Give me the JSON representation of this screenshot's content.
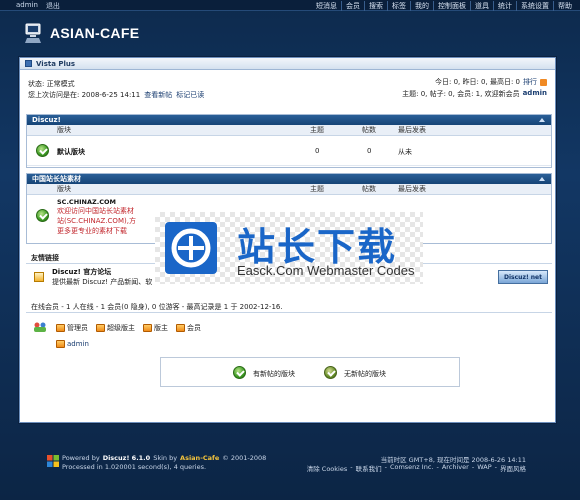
{
  "topbar": {
    "username": "admin",
    "logout": "退出",
    "nav": [
      "短消息",
      "会员",
      "搜索",
      "标签",
      "我的",
      "控制面板",
      "道具",
      "统计",
      "系统设置",
      "帮助"
    ]
  },
  "logo": {
    "text": "ASIAN-CAFE"
  },
  "window": {
    "title": "Vista Plus"
  },
  "status": {
    "mode": "状态: 正常模式",
    "last_visit": "您上次访问是在: 2008-6-25 14:11",
    "view_new": "查看新帖",
    "mark_read": "标记已读",
    "stats_today": "今日: 0, 昨日: 0, 最高日: 0",
    "ranking": "排行",
    "stats_totals": "主题: 0, 帖子: 0, 会员: 1, 欢迎新会员",
    "newest_member": "admin"
  },
  "discuz_section": {
    "title": "Discuz!",
    "columns": [
      "版块",
      "主题",
      "帖数",
      "最后发表"
    ],
    "rows": [
      {
        "name": "默认版块",
        "topics": "0",
        "posts": "0",
        "last": "从未"
      }
    ]
  },
  "chinaz_section": {
    "title": "中国站长站素材",
    "columns": [
      "版块",
      "主题",
      "帖数",
      "最后发表"
    ],
    "forum_name": "SC.CHINAZ.COM",
    "desc_line1": "欢迎访问中国站长站素材",
    "desc_line2": "站(SC.CHINAZ.COM),方",
    "desc_line3": "更多更专业的素材下载"
  },
  "links_section": {
    "title": "友情链接",
    "site_name": "Discuz! 官方论坛",
    "site_desc": "提供最新 Discuz! 产品新闻、软",
    "badge": "Discuz! net"
  },
  "online": {
    "summary": "在线会员 - 1 人在线 - 1 会员(0 隐身), 0 位游客 - 最高记录是 1 于 2002-12-16.",
    "groups": [
      "管理员",
      "超级版主",
      "版主",
      "会员"
    ],
    "users": [
      "admin"
    ]
  },
  "legend": {
    "new": "有新帖的版块",
    "none": "无新帖的版块"
  },
  "watermark": {
    "big": "站长下载",
    "small": "Easck.Com Webmaster Codes"
  },
  "footer": {
    "powered_prefix": "Powered by",
    "product": "Discuz! 6.1.0",
    "skin_prefix": "Skin by",
    "skin": "Asian-Cafe",
    "copyright": "© 2001-2008",
    "processed": "Processed in 1.020001 second(s), 4 queries.",
    "timezone": "当前时区 GMT+8, 现在时间是 2008-6-26 14:11",
    "links": [
      "清除 Cookies",
      "联系我们",
      "Comsenz Inc.",
      "Archiver",
      "WAP",
      "界面风格"
    ]
  },
  "colors": {
    "accent": "#164476",
    "brand_red": "#c2272d",
    "watermark_blue": "#1a66c8"
  }
}
